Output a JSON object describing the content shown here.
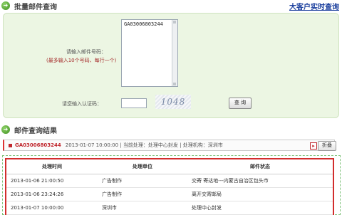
{
  "section_query": {
    "title": "批量邮件查询"
  },
  "big_client_link": "大客户实时查询",
  "form": {
    "number_label": "请输入邮件号码：",
    "number_hint": "(最多输入10个号码、每行一个)",
    "number_value": "GA03006803244",
    "captcha_label": "请您输入认证码：",
    "captcha_text": "1048",
    "query_button": "查 询"
  },
  "section_result": {
    "title": "邮件查询结果"
  },
  "result_bar": {
    "tracking_no": "GA03006803244",
    "summary": "2013-01-07 10:00:00 | 当前处理：处理中心封发 | 处理机构：深圳市",
    "collapse_button": "折叠"
  },
  "table": {
    "headers": [
      "处理时间",
      "处理单位",
      "邮件状态"
    ],
    "rows": [
      [
        "2013-01-06 21:00:50",
        "广告制作",
        "交寄 寄达地---内蒙古自治区包头市"
      ],
      [
        "2013-01-06 23:24:26",
        "广告制作",
        "离开交寄邮局"
      ],
      [
        "2013-01-07 10:00:00",
        "深圳市",
        "处理中心封发"
      ]
    ]
  },
  "colors": {
    "accent_red": "#c0272d",
    "panel_green": "#ecf6e3",
    "link_blue": "#1b3f9e"
  }
}
